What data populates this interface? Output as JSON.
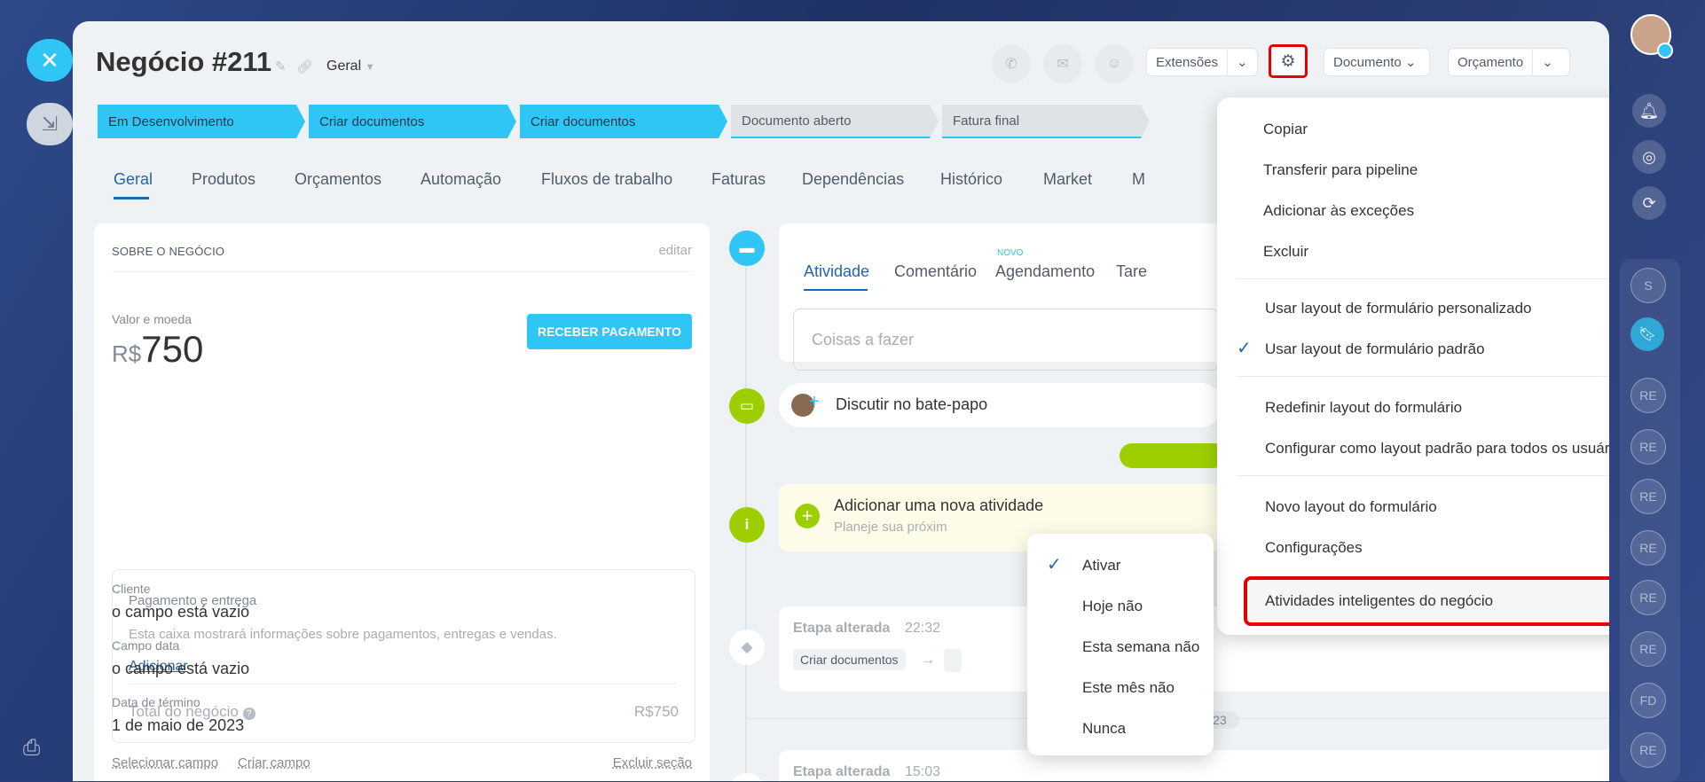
{
  "deal": {
    "title": "Negócio #211",
    "category": "Geral",
    "toolbar": {
      "extensions": "Extensões",
      "document": "Documento",
      "estimate": "Orçamento"
    }
  },
  "stages": [
    {
      "label": "Em Desenvolvimento",
      "active": true
    },
    {
      "label": "Criar documentos",
      "active": true
    },
    {
      "label": "Criar documentos",
      "active": true
    },
    {
      "label": "Documento aberto",
      "active": false
    },
    {
      "label": "Fatura final",
      "active": false
    }
  ],
  "tabs": [
    "Geral",
    "Produtos",
    "Orçamentos",
    "Automação",
    "Fluxos de trabalho",
    "Faturas",
    "Dependências",
    "Histórico",
    "Market",
    "M"
  ],
  "about": {
    "heading": "SOBRE O NEGÓCIO",
    "edit": "editar",
    "amount_label": "Valor e moeda",
    "currency": "R$",
    "amount": "750",
    "pay_button": "RECEBER PAGAMENTO",
    "payment_heading": "Pagamento e entrega",
    "payment_desc": "Esta caixa mostrará informações sobre pagamentos, entregas e vendas.",
    "add_link": "Adicionar",
    "total_label": "Total do negócio",
    "total_value": "R$750",
    "client_label": "Cliente",
    "client_value": "o campo está vazio",
    "date_label": "Campo data",
    "date_value": "o campo está vazio",
    "end_label": "Data de término",
    "end_value": "1 de maio de 2023",
    "select_field": "Selecionar campo",
    "create_field": "Criar campo",
    "delete_section": "Excluir seção"
  },
  "activity": {
    "tabs": [
      "Atividade",
      "Comentário",
      "Agendamento",
      "Tare"
    ],
    "new_badge": "NOVO",
    "todo_placeholder": "Coisas a fazer",
    "chat": "Discutir no bate-papo",
    "add_title": "Adicionar uma nova atividade",
    "add_sub": "Planeje sua próxim",
    "stage_changed": "Etapa alterada",
    "time1": "22:32",
    "from_stage": "Criar documentos",
    "date_divider": "dezembro de 2023",
    "time2": "15:03"
  },
  "menu": {
    "items": [
      "Copiar",
      "Transferir para pipeline",
      "Adicionar às exceções",
      "Excluir"
    ],
    "layout_items": [
      "Usar layout de formulário personalizado",
      "Usar layout de formulário padrão"
    ],
    "form_items": [
      "Redefinir layout do formulário",
      "Configurar como layout padrão para todos os usuários"
    ],
    "other_items": [
      "Novo layout do formulário",
      "Configurações"
    ],
    "smart": "Atividades inteligentes do negócio"
  },
  "submenu": [
    "Ativar",
    "Hoje não",
    "Esta semana não",
    "Este mês não",
    "Nunca"
  ],
  "rail": [
    "S",
    "RE",
    "RE",
    "RE",
    "RE",
    "RE",
    "RE",
    "FD",
    "RE"
  ],
  "colors": {
    "accent": "#2fc6f6",
    "link": "#2067b0",
    "highlight": "#e60000",
    "success": "#9dcf00"
  }
}
